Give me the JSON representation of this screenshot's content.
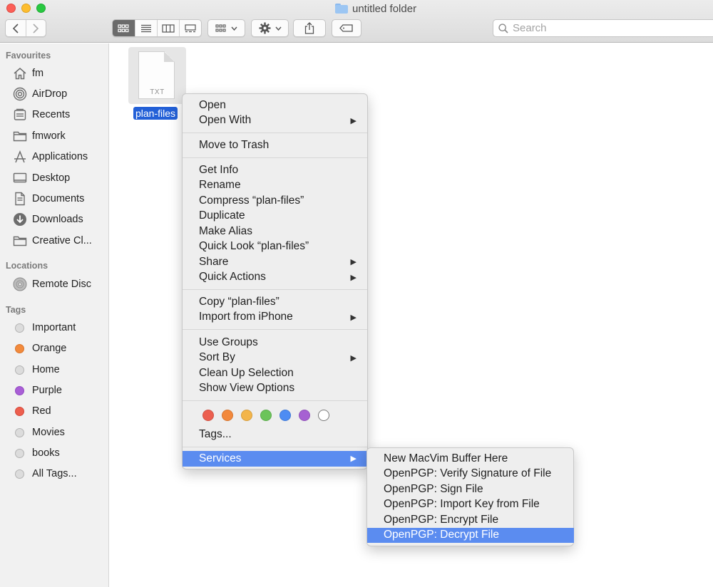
{
  "window": {
    "title": "untitled folder"
  },
  "toolbar": {
    "search_placeholder": "Search"
  },
  "sidebar": {
    "favourites_heading": "Favourites",
    "favourites": [
      {
        "label": "fm",
        "icon": "home-icon"
      },
      {
        "label": "AirDrop",
        "icon": "airdrop-icon"
      },
      {
        "label": "Recents",
        "icon": "recents-icon"
      },
      {
        "label": "fmwork",
        "icon": "folder-icon"
      },
      {
        "label": "Applications",
        "icon": "applications-icon"
      },
      {
        "label": "Desktop",
        "icon": "desktop-icon"
      },
      {
        "label": "Documents",
        "icon": "documents-icon"
      },
      {
        "label": "Downloads",
        "icon": "downloads-icon"
      },
      {
        "label": "Creative Cl...",
        "icon": "folder-icon"
      }
    ],
    "locations_heading": "Locations",
    "locations": [
      {
        "label": "Remote Disc",
        "icon": "disc-icon"
      }
    ],
    "tags_heading": "Tags",
    "tags": [
      {
        "label": "Important",
        "color": "#dcdcdc"
      },
      {
        "label": "Orange",
        "color": "#f28a3c"
      },
      {
        "label": "Home",
        "color": "#dcdcdc"
      },
      {
        "label": "Purple",
        "color": "#a95fd6"
      },
      {
        "label": "Red",
        "color": "#ed5f4e"
      },
      {
        "label": "Movies",
        "color": "#dcdcdc"
      },
      {
        "label": "books",
        "color": "#dcdcdc"
      },
      {
        "label": "All Tags...",
        "color": "#dcdcdc"
      }
    ]
  },
  "file": {
    "name": "plan-files",
    "ext": "TXT"
  },
  "context_menu": {
    "open": "Open",
    "open_with": "Open With",
    "move_to_trash": "Move to Trash",
    "get_info": "Get Info",
    "rename": "Rename",
    "compress": "Compress “plan-files”",
    "duplicate": "Duplicate",
    "make_alias": "Make Alias",
    "quick_look": "Quick Look “plan-files”",
    "share": "Share",
    "quick_actions": "Quick Actions",
    "copy": "Copy “plan-files”",
    "import_iphone": "Import from iPhone",
    "use_groups": "Use Groups",
    "sort_by": "Sort By",
    "clean_up": "Clean Up Selection",
    "show_view_options": "Show View Options",
    "tag_colors": [
      "#ec5f4f",
      "#f2883b",
      "#f3b54a",
      "#6cc45a",
      "#4d8cf3",
      "#a661d2",
      "#ffffff"
    ],
    "tags": "Tags...",
    "services": "Services",
    "arrow": "▶"
  },
  "services_menu": {
    "items": [
      "New MacVim Buffer Here",
      "OpenPGP: Verify Signature of File",
      "OpenPGP: Sign File",
      "OpenPGP: Import Key from File",
      "OpenPGP: Encrypt File",
      "OpenPGP: Decrypt File"
    ],
    "highlighted_index": 5
  }
}
